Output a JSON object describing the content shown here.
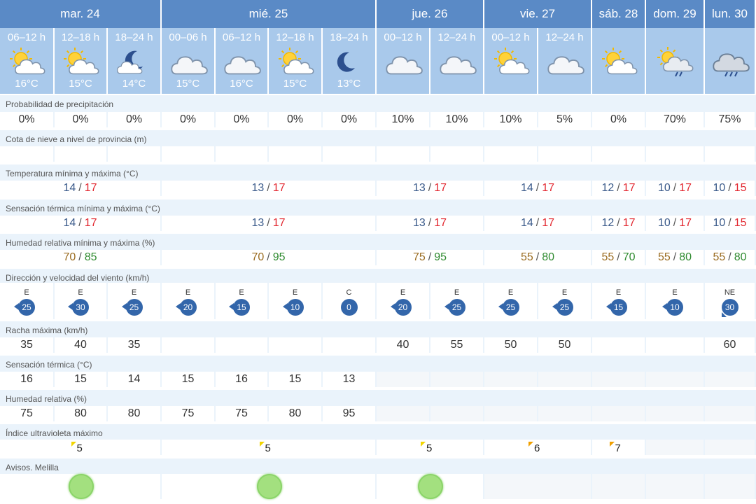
{
  "days": [
    {
      "label": "mar. 24",
      "icon": "day-group"
    },
    {
      "label": "mié. 25",
      "icon": "day-group"
    },
    {
      "label": "jue. 26",
      "icon": "day-group"
    },
    {
      "label": "vie. 27",
      "icon": "day-group"
    },
    {
      "label": "sáb. 28",
      "icon": "day-group"
    },
    {
      "label": "dom. 29",
      "icon": "day-group"
    },
    {
      "label": "lun. 30",
      "icon": "day-group"
    }
  ],
  "periods": [
    {
      "label": "06–12 h",
      "icon": "sun-cloud-icon",
      "temp": "16°C"
    },
    {
      "label": "12–18 h",
      "icon": "sun-cloud-icon",
      "temp": "15°C"
    },
    {
      "label": "18–24 h",
      "icon": "moon-cloud-icon",
      "temp": "14°C"
    },
    {
      "label": "00–06 h",
      "icon": "cloud-icon",
      "temp": "15°C"
    },
    {
      "label": "06–12 h",
      "icon": "cloud-icon",
      "temp": "16°C"
    },
    {
      "label": "12–18 h",
      "icon": "sun-cloud-icon",
      "temp": "15°C"
    },
    {
      "label": "18–24 h",
      "icon": "moon-icon",
      "temp": "13°C"
    },
    {
      "label": "00–12 h",
      "icon": "cloud-icon",
      "temp": ""
    },
    {
      "label": "12–24 h",
      "icon": "cloud-icon",
      "temp": ""
    },
    {
      "label": "00–12 h",
      "icon": "sun-cloud-icon",
      "temp": ""
    },
    {
      "label": "12–24 h",
      "icon": "cloud-icon",
      "temp": ""
    },
    {
      "label": "",
      "icon": "sun-cloud-icon",
      "temp": ""
    },
    {
      "label": "",
      "icon": "sun-cloud-rain-icon",
      "temp": ""
    },
    {
      "label": "",
      "icon": "cloud-rain-icon",
      "temp": ""
    }
  ],
  "labels": {
    "precip": "Probabilidad de precipitación",
    "snow": "Cota de nieve a nivel de provincia (m)",
    "temp": "Temperatura mínima y máxima (°C)",
    "feels_minmax": "Sensación térmica mínima y máxima (°C)",
    "hum_minmax": "Humedad relativa mínima y máxima (%)",
    "wind": "Dirección y velocidad del viento (km/h)",
    "gust": "Racha máxima (km/h)",
    "feels": "Sensación térmica (°C)",
    "hum": "Humedad relativa (%)",
    "uv": "Índice ultravioleta máximo",
    "alerts": "Avisos. Melilla"
  },
  "precip": [
    "0%",
    "0%",
    "0%",
    "0%",
    "0%",
    "0%",
    "0%",
    "10%",
    "10%",
    "10%",
    "5%",
    "0%",
    "70%",
    "75%"
  ],
  "snow": [
    "",
    "",
    "",
    "",
    "",
    "",
    "",
    "",
    "",
    "",
    "",
    "",
    "",
    ""
  ],
  "temp_minmax": [
    {
      "min": "14",
      "max": "17"
    },
    {
      "min": "13",
      "max": "17"
    },
    {
      "min": "13",
      "max": "17"
    },
    {
      "min": "14",
      "max": "17"
    },
    {
      "min": "12",
      "max": "17"
    },
    {
      "min": "10",
      "max": "17"
    },
    {
      "min": "10",
      "max": "15"
    }
  ],
  "feels_minmax": [
    {
      "min": "14",
      "max": "17"
    },
    {
      "min": "13",
      "max": "17"
    },
    {
      "min": "13",
      "max": "17"
    },
    {
      "min": "14",
      "max": "17"
    },
    {
      "min": "12",
      "max": "17"
    },
    {
      "min": "10",
      "max": "17"
    },
    {
      "min": "10",
      "max": "15"
    }
  ],
  "hum_minmax": [
    {
      "min": "70",
      "max": "85"
    },
    {
      "min": "70",
      "max": "95"
    },
    {
      "min": "75",
      "max": "95"
    },
    {
      "min": "55",
      "max": "80"
    },
    {
      "min": "55",
      "max": "70"
    },
    {
      "min": "55",
      "max": "80"
    },
    {
      "min": "55",
      "max": "80"
    }
  ],
  "sep": "/",
  "wind": [
    {
      "dir": "E",
      "speed": "25"
    },
    {
      "dir": "E",
      "speed": "30"
    },
    {
      "dir": "E",
      "speed": "25"
    },
    {
      "dir": "E",
      "speed": "20"
    },
    {
      "dir": "E",
      "speed": "15"
    },
    {
      "dir": "E",
      "speed": "10"
    },
    {
      "dir": "C",
      "speed": "0"
    },
    {
      "dir": "E",
      "speed": "20"
    },
    {
      "dir": "E",
      "speed": "25"
    },
    {
      "dir": "E",
      "speed": "25"
    },
    {
      "dir": "E",
      "speed": "25"
    },
    {
      "dir": "E",
      "speed": "15"
    },
    {
      "dir": "E",
      "speed": "10"
    },
    {
      "dir": "NE",
      "speed": "30"
    }
  ],
  "gust": [
    "35",
    "40",
    "35",
    "",
    "",
    "",
    "",
    "40",
    "55",
    "50",
    "50",
    "",
    "",
    "60"
  ],
  "feels": [
    "16",
    "15",
    "14",
    "15",
    "16",
    "15",
    "13"
  ],
  "hum": [
    "75",
    "80",
    "80",
    "75",
    "75",
    "80",
    "95"
  ],
  "uv": [
    {
      "value": "5",
      "level": "moderate"
    },
    {
      "value": "5",
      "level": "moderate"
    },
    {
      "value": "5",
      "level": "moderate"
    },
    {
      "value": "6",
      "level": "high"
    },
    {
      "value": "7",
      "level": "high"
    }
  ],
  "alerts": [
    {
      "status": "green"
    },
    {
      "status": "green"
    },
    {
      "status": "green"
    }
  ],
  "colors": {
    "header_bg": "#5a8ac6",
    "period_bg": "#a9c9eb",
    "label_row_bg": "#eaf3fb",
    "min_value": "#3a5a8a",
    "max_value": "#e2262e",
    "hum_min": "#9a6b1f",
    "hum_max": "#2f8a2f",
    "wind_badge": "#3366aa",
    "uv_moderate": "#f2d500",
    "uv_high": "#f0a000",
    "alert_green": "#a3e07f"
  }
}
